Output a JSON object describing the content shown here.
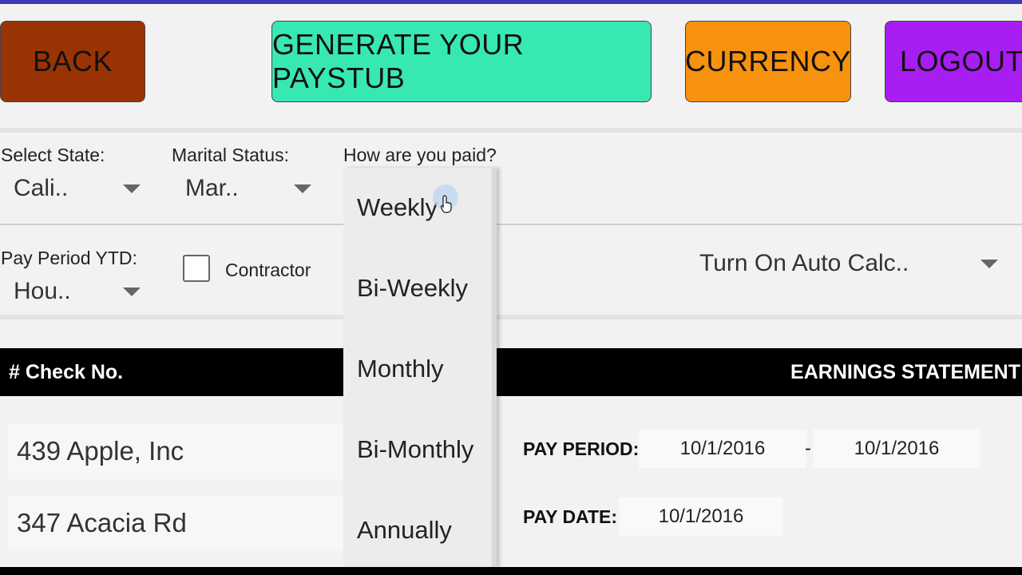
{
  "header": {
    "back_label": "BACK",
    "generate_label": "GENERATE YOUR PAYSTUB",
    "currency_label": "CURRENCY",
    "logout_label": "LOGOUT"
  },
  "form": {
    "state_label": "Select State:",
    "state_value": "Cali..",
    "marital_label": "Marital Status:",
    "marital_value": "Mar..",
    "paid_label": "How are you paid?",
    "ytd_label": "Pay Period YTD:",
    "ytd_value": "Hou..",
    "contractor_label": "Contractor",
    "auto_calc_value": "Turn On Auto Calc.."
  },
  "pay_dropdown": {
    "options": [
      "Weekly",
      "Bi-Weekly",
      "Monthly",
      "Bi-Monthly",
      "Annually"
    ]
  },
  "check": {
    "header_label": "# Check No.",
    "company_name": "439 Apple, Inc",
    "company_address": "347 Acacia Rd"
  },
  "statement": {
    "header_label": "EARNINGS STATEMENT",
    "pay_period_label": "PAY PERIOD:",
    "pay_period_start": "10/1/2016",
    "pay_period_separator": "-",
    "pay_period_end": "10/1/2016",
    "pay_date_label": "PAY DATE:",
    "pay_date_value": "10/1/2016"
  },
  "colors": {
    "back": "#9a3304",
    "generate": "#38e8b3",
    "currency": "#f7920f",
    "logout": "#a81df2"
  }
}
